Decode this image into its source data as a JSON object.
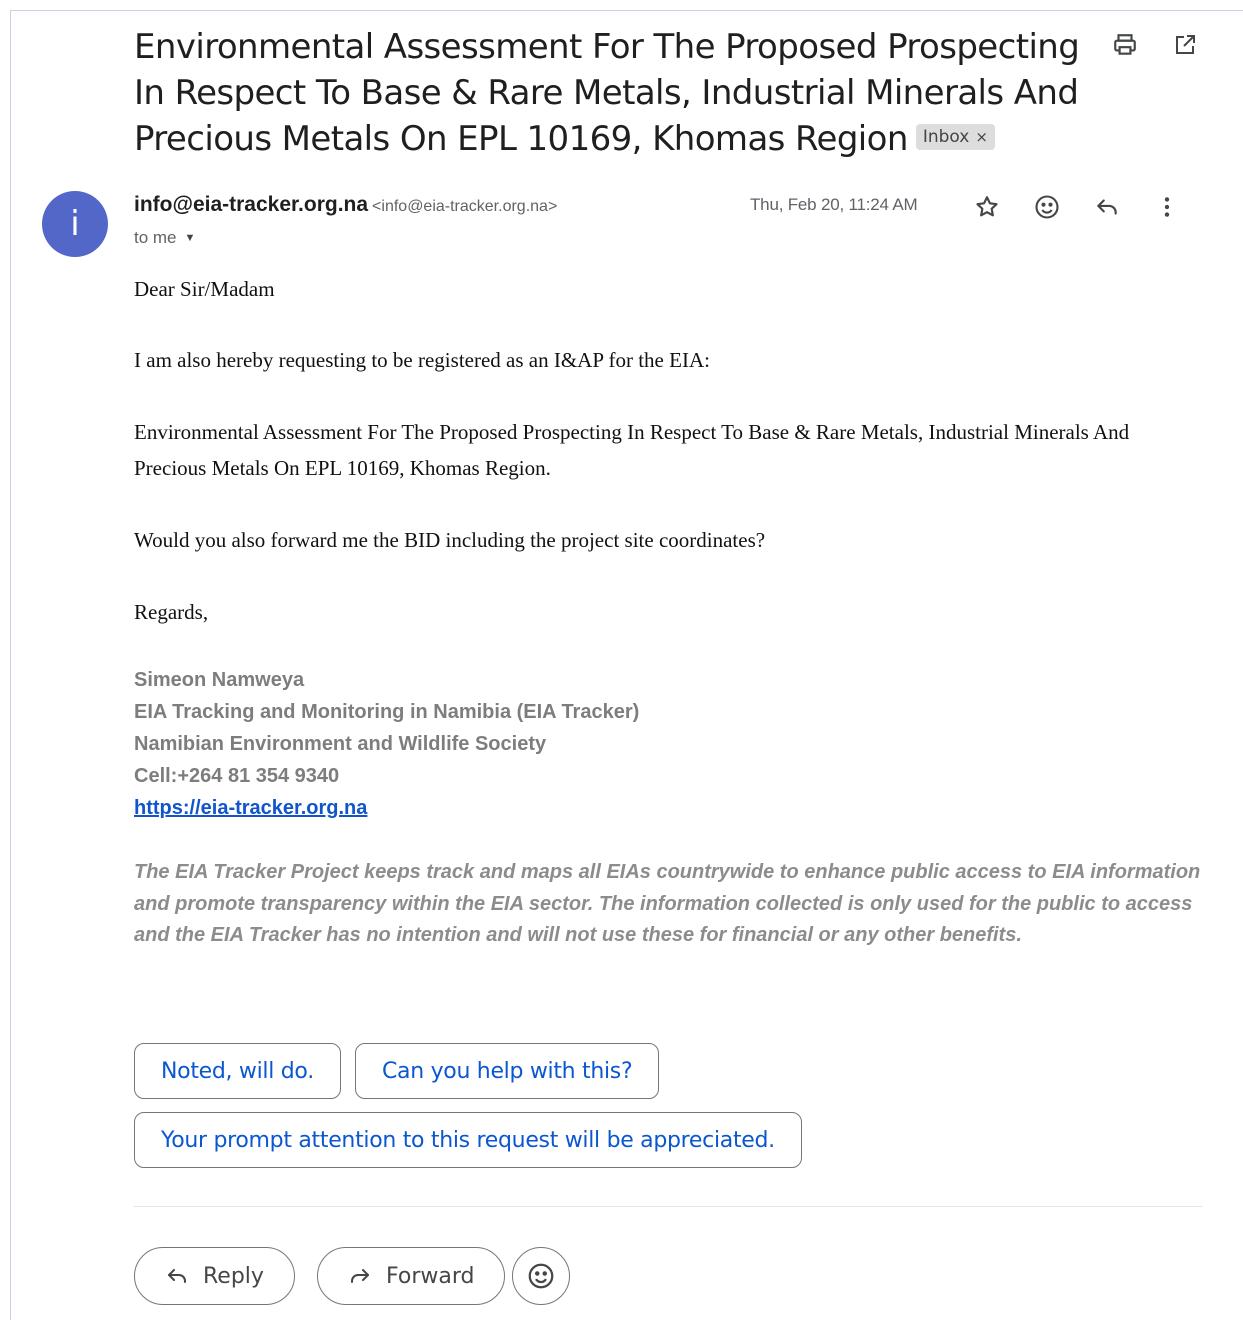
{
  "email": {
    "subject": "Environmental Assessment For The Proposed Prospecting In Respect To Base & Rare Metals, Industrial Minerals And Precious Metals On EPL 10169, Khomas Region",
    "label": "Inbox",
    "label_remove": "×",
    "avatar_letter": "i",
    "sender_name": "info@eia-tracker.org.na",
    "sender_email": "<info@eia-tracker.org.na>",
    "recipient": "to me",
    "date": "Thu, Feb 20, 11:24 AM",
    "body": {
      "greeting": "Dear Sir/Madam",
      "p1": "I am also hereby requesting to be registered as an I&AP for the EIA:",
      "p2": "Environmental Assessment For The Proposed Prospecting In Respect To Base & Rare Metals, Industrial Minerals And Precious Metals On EPL 10169, Khomas Region.",
      "p3": "Would you also forward me the BID including the project site coordinates?",
      "closing": "Regards,"
    },
    "signature": {
      "name": "Simeon Namweya",
      "line1": "EIA Tracking and Monitoring in Namibia (EIA Tracker)",
      "line2": "Namibian Environment and Wildlife Society",
      "cell": "Cell:+264 81 354 9340",
      "link": "https://eia-tracker.org.na"
    },
    "disclaimer": "The EIA Tracker Project keeps track and maps all EIAs countrywide to enhance public access to EIA information and promote transparency within the EIA sector. The information collected is only used for the public to access and the EIA Tracker has no intention and will not use these for financial or any other benefits."
  },
  "smart_replies": [
    "Noted, will do.",
    "Can you help with this?",
    "Your prompt attention to this request will be appreciated."
  ],
  "actions": {
    "reply": "Reply",
    "forward": "Forward"
  },
  "icons": {
    "toolbar": [
      "print-icon",
      "open-in-new-window-icon"
    ],
    "message": [
      "star-icon",
      "emoji-react-icon",
      "reply-icon",
      "more-options-icon"
    ]
  },
  "colors": {
    "avatar": "#5367c9",
    "link": "#1155cc",
    "smart_reply_text": "#0b57d0"
  }
}
